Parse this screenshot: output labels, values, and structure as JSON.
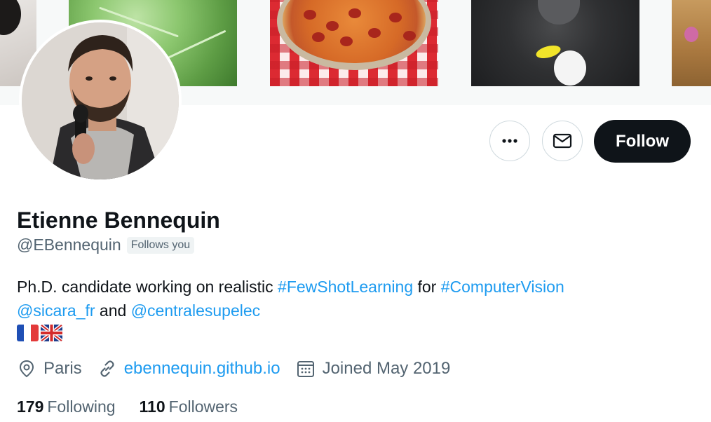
{
  "profile": {
    "name": "Etienne Bennequin",
    "handle": "@EBennequin",
    "follows_you": "Follows you",
    "follow_label": "Follow",
    "bio": {
      "line1_text": "Ph.D. candidate working on realistic ",
      "tag1": "#FewShotLearning",
      "line1_mid": " for ",
      "tag2": "#ComputerVision",
      "mention1": "@sicara_fr",
      "line2_mid": " and ",
      "mention2": "@centralesupelec"
    },
    "flags": [
      "france-flag",
      "uk-flag"
    ],
    "location": "Paris",
    "website": "ebennequin.github.io",
    "joined": "Joined May 2019",
    "following_count": "179",
    "following_label": "Following",
    "followers_count": "110",
    "followers_label": "Followers"
  },
  "icons": {
    "more": "more-dots-icon",
    "message": "envelope-icon",
    "location": "location-pin-icon",
    "link": "link-icon",
    "calendar": "calendar-icon"
  },
  "colors": {
    "accent": "#1d9bf0",
    "text_primary": "#0f1419",
    "text_secondary": "#536471",
    "button_dark": "#0f1419",
    "border": "#cfd9de"
  }
}
